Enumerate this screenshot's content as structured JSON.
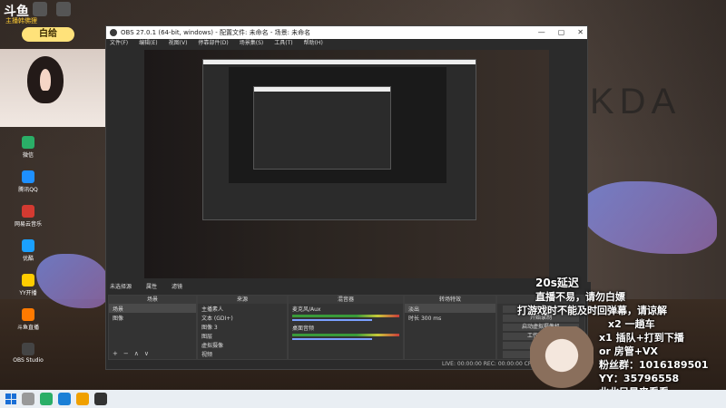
{
  "stream": {
    "logo": "斗鱼",
    "sub_logo": "主播韩佛狸",
    "nameplate": "白给",
    "brand_wall": "KDA"
  },
  "desktop_icons": [
    {
      "label": "微信",
      "color": "#2aae67"
    },
    {
      "label": "腾讯QQ",
      "color": "#1e90ff"
    },
    {
      "label": "网易云音乐",
      "color": "#d33a31"
    },
    {
      "label": "优酷",
      "color": "#1aa0ff"
    },
    {
      "label": "YY开播",
      "color": "#ffcc00"
    },
    {
      "label": "斗鱼直播",
      "color": "#ff7a00"
    },
    {
      "label": "OBS Studio",
      "color": "#444"
    }
  ],
  "obs": {
    "title": "OBS 27.0.1 (64-bit, windows) - 配置文件: 未命名 - 场景: 未命名",
    "window_controls": [
      "—",
      "▢",
      "✕"
    ],
    "menu": [
      "文件(F)",
      "编辑(E)",
      "视图(V)",
      "停靠部件(D)",
      "场景集(S)",
      "工具(T)",
      "帮助(H)"
    ],
    "docks_bar": [
      "未选择源",
      "属性",
      "滤镜"
    ],
    "scenes": {
      "header": "场景",
      "items": [
        "场景",
        "图像"
      ]
    },
    "sources": {
      "header": "来源",
      "items": [
        "主播素人",
        "文本 (GDI+)",
        "图像 3",
        "图层",
        "虚拟摄像",
        "视频"
      ]
    },
    "mixer": {
      "header": "混音器",
      "channels": [
        {
          "name": "麦克风/Aux",
          "db": "0.0 dB"
        },
        {
          "name": "桌面音频",
          "db": "0.0 dB"
        }
      ]
    },
    "transitions": {
      "header": "转场特效",
      "type": "淡出",
      "duration_label": "时长",
      "duration": "300 ms"
    },
    "controls": {
      "header": "控件",
      "buttons": [
        "开始推流",
        "开始录制",
        "启动虚拟摄像机",
        "工作室模式",
        "设置",
        "退出"
      ]
    },
    "status": "LIVE: 00:00:00   REC: 00:00:00   CPU: 1.9%, 60.00 fps"
  },
  "overlay": {
    "line1": "20s延迟",
    "line2": "直播不易，请勿白嫖",
    "line3": "打游戏时不能及时回弹幕，请谅解",
    "line4": "x2 一趟车",
    "line5": "x1 插队+打到下播",
    "line6": "or 房管+VX",
    "line7": "粉丝群：1016189501",
    "line8": "YY：35796558",
    "line9": "北北只是来看看"
  },
  "taskbar": {
    "icons": [
      "start",
      "search",
      "wechat",
      "edge",
      "browser",
      "obs"
    ]
  }
}
